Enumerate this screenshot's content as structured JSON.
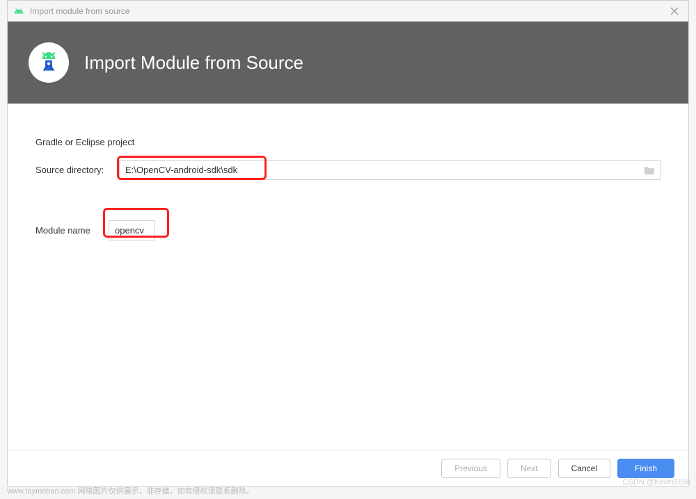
{
  "titlebar": {
    "text": "Import module from source"
  },
  "header": {
    "title": "Import Module from Source"
  },
  "content": {
    "section_label": "Gradle or Eclipse project",
    "source_label": "Source directory:",
    "source_value": "E:\\OpenCV-android-sdk\\sdk",
    "module_label": "Module name",
    "module_value": "opencv"
  },
  "footer": {
    "previous": "Previous",
    "next": "Next",
    "cancel": "Cancel",
    "finish": "Finish"
  },
  "watermark": {
    "left": "www.toymoban.com 网络图片仅供展示，非存储，如有侵权请联系删除。",
    "right": "CSDN @Kevin5158"
  }
}
